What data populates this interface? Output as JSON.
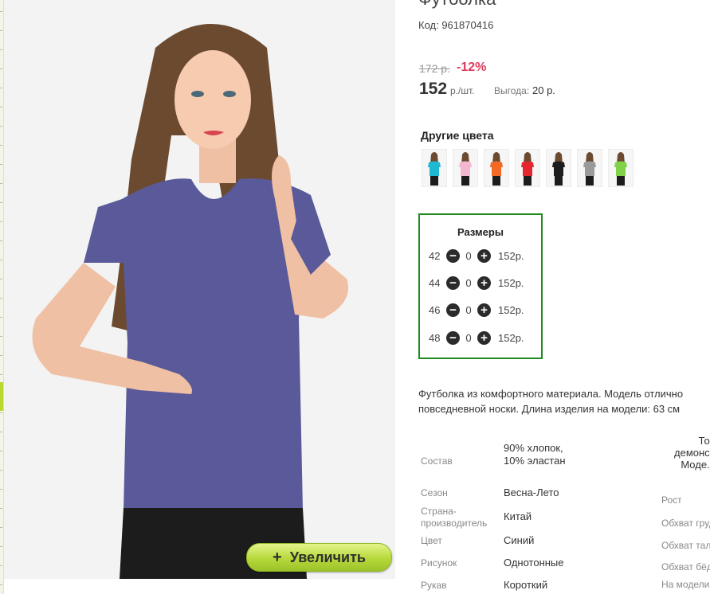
{
  "product": {
    "title": "Футболка",
    "code": "Код: 961870416",
    "old_price": "172 р.",
    "discount": "-12%",
    "price": "152",
    "price_unit": "р./шт.",
    "benefit_label": "Выгода:",
    "benefit_value": "20 р.",
    "zoom_label": "Увеличить",
    "zoom_plus": "+"
  },
  "colors": {
    "heading": "Другие цвета",
    "items": [
      {
        "name": "бирюзовый",
        "hex": "#1fb8d3"
      },
      {
        "name": "розовый",
        "hex": "#f3b8cf"
      },
      {
        "name": "оранжевый",
        "hex": "#f26a25"
      },
      {
        "name": "красный",
        "hex": "#e3262f"
      },
      {
        "name": "черный",
        "hex": "#1c1c1c"
      },
      {
        "name": "серый",
        "hex": "#9a9a9a"
      },
      {
        "name": "салатовый",
        "hex": "#7fd24a"
      }
    ]
  },
  "sizes": {
    "title": "Размеры",
    "minus": "−",
    "plus": "+",
    "rows": [
      {
        "size": "42",
        "qty": "0",
        "price": "152р."
      },
      {
        "size": "44",
        "qty": "0",
        "price": "152р."
      },
      {
        "size": "46",
        "qty": "0",
        "price": "152р."
      },
      {
        "size": "48",
        "qty": "0",
        "price": "152р."
      }
    ]
  },
  "description": {
    "line1": "Футболка из комфортного материала. Модель отлично",
    "line2": "повседневной носки. Длина изделия на модели: 63 см"
  },
  "specs": [
    {
      "label": "Состав",
      "value": "90% хлопок, 10% эластан"
    },
    {
      "label": "Сезон",
      "value": "Весна-Лето"
    },
    {
      "label": "Страна-производитель",
      "value": "Китай"
    },
    {
      "label": "Цвет",
      "value": "Синий"
    },
    {
      "label": "Рисунок",
      "value": "Однотонные"
    },
    {
      "label": "Рукав",
      "value": "Короткий"
    }
  ],
  "model_note": {
    "line1": "То",
    "line2": "демонс",
    "line3": "Моде."
  },
  "model_params": [
    "Рост",
    "Обхват груди",
    "Обхват тал",
    "Обхват бёд",
    "На модели"
  ],
  "theme": {
    "accent_green": "#1f8a1f",
    "discount_red": "#e03a5a",
    "button_green": "#b6d83a",
    "shirt_color": "#5a5a9a"
  }
}
